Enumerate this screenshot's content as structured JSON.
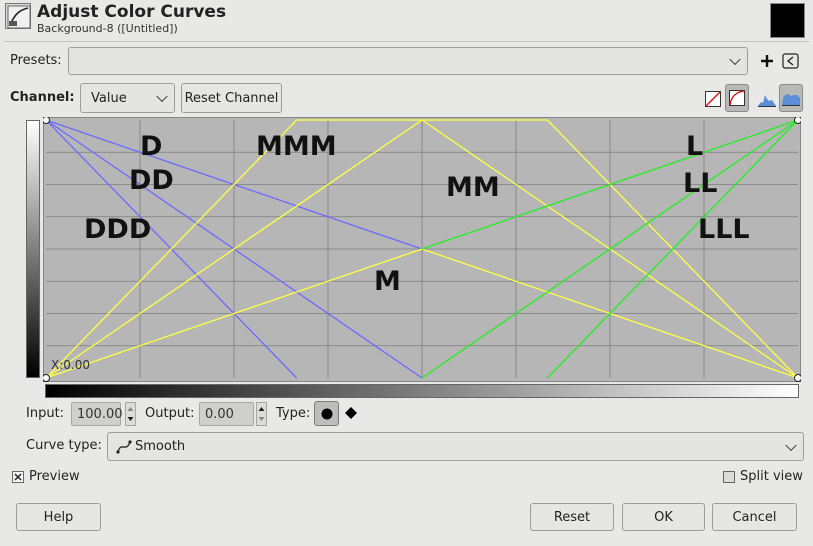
{
  "header": {
    "title": "Adjust Color Curves",
    "subtitle": "Background-8 ([Untitled])"
  },
  "presets": {
    "label": "Presets:",
    "value": ""
  },
  "channel": {
    "label": "Channel:",
    "value": "Value",
    "reset_label": "Reset Channel"
  },
  "graph": {
    "coordinate_readout": "X:0.00",
    "letters": [
      "D",
      "DD",
      "DDD",
      "MMM",
      "MM",
      "M",
      "L",
      "LL",
      "LLL"
    ],
    "colors": {
      "blue": "#6b6bff",
      "yellow": "#ffff44",
      "green": "#22ee22",
      "background": "#b6b6b6"
    }
  },
  "point": {
    "input_label": "Input:",
    "input_value": "100.00",
    "output_label": "Output:",
    "output_value": "0.00",
    "type_label": "Type:"
  },
  "curve_type": {
    "label": "Curve type:",
    "value": "Smooth"
  },
  "options": {
    "preview_label": "Preview",
    "preview_checked": true,
    "split_view_label": "Split view",
    "split_view_checked": false
  },
  "buttons": {
    "help": "Help",
    "reset": "Reset",
    "ok": "OK",
    "cancel": "Cancel"
  }
}
